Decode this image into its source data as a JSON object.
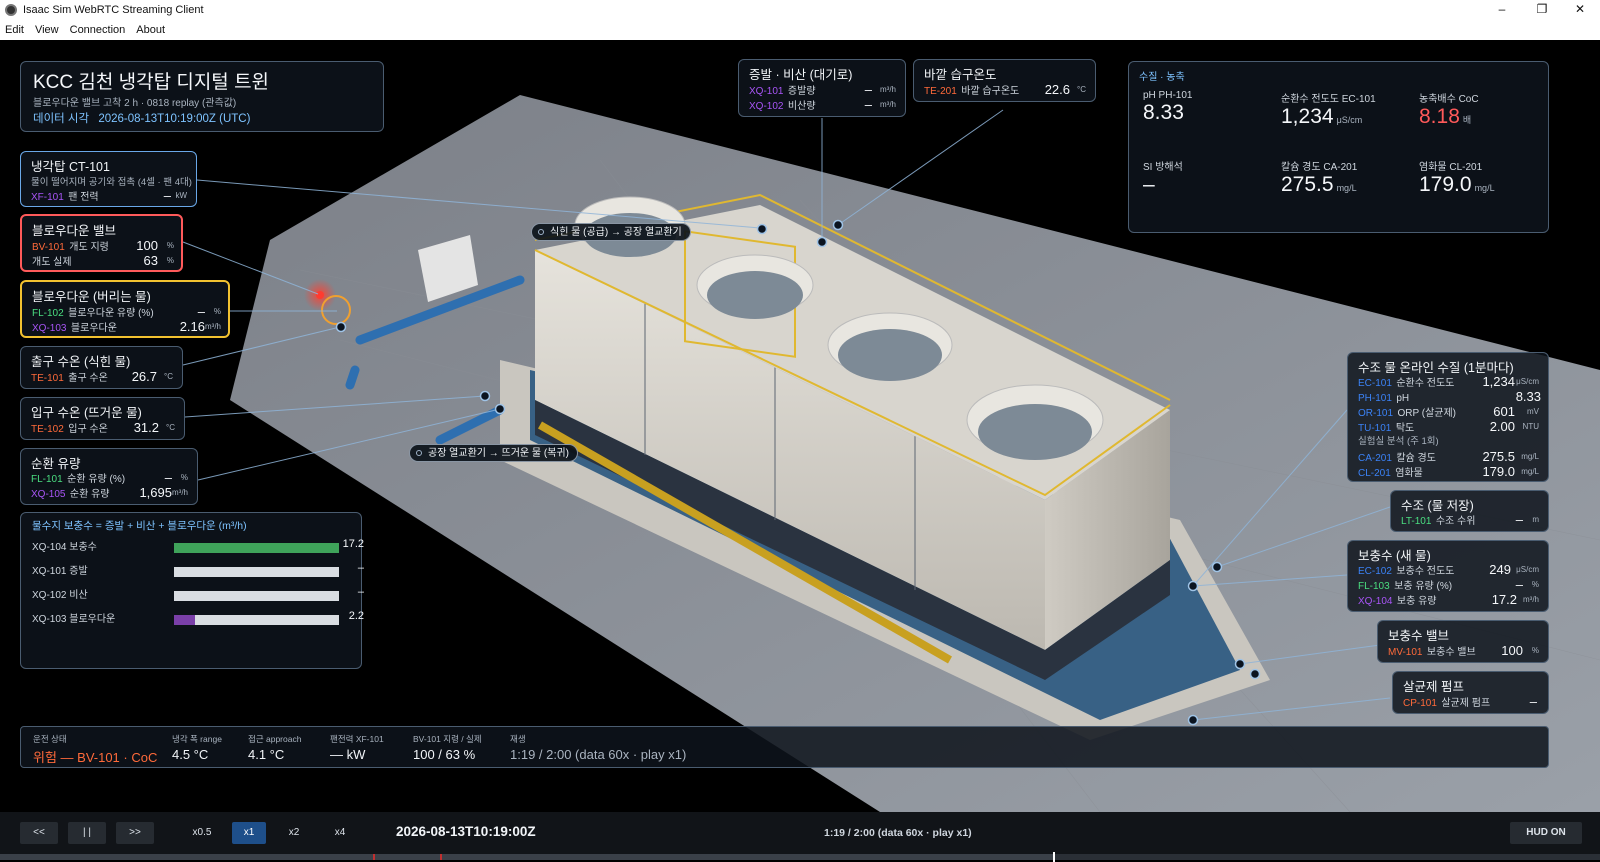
{
  "window": {
    "title": "Isaac Sim WebRTC Streaming Client",
    "min": "–",
    "max": "❐",
    "close": "✕"
  },
  "menu": [
    "Edit",
    "View",
    "Connection",
    "About"
  ],
  "header": {
    "title": "KCC 김천 냉각탑 디지털 트윈",
    "subtitle": "블로우다운 밸브 고착 2 h · 0818 replay (관측값)",
    "data_time_label": "데이터 시각",
    "data_time": "2026-08-13T10:19:00Z (UTC)"
  },
  "evap_panel": {
    "title": "증발 · 비산 (대기로)",
    "rows": [
      {
        "tag": "XQ-101",
        "label": "증발량",
        "value": "–",
        "unit": "m³/h"
      },
      {
        "tag": "XQ-102",
        "label": "비산량",
        "value": "–",
        "unit": "m³/h"
      }
    ]
  },
  "wetbulb_panel": {
    "title": "바깥 습구온도",
    "tag": "TE-201",
    "label": "바깥 습구온도",
    "value": "22.6",
    "unit": "°C"
  },
  "water_quality": {
    "title": "수질 · 농축",
    "items": [
      {
        "label": "pH  PH-101",
        "value": "8.33",
        "unit": ""
      },
      {
        "label": "순환수 전도도  EC-101",
        "value": "1,234",
        "unit": "μS/cm"
      },
      {
        "label": "농축배수 CoC",
        "value": "8.18",
        "unit": "배"
      },
      {
        "label": "SI 방해석",
        "value": "–",
        "unit": ""
      },
      {
        "label": "칼슘 경도  CA-201",
        "value": "275.5",
        "unit": "mg/L"
      },
      {
        "label": "염화물  CL-201",
        "value": "179.0",
        "unit": "mg/L"
      }
    ],
    "alert_color": "#ff5a5a"
  },
  "tower_panel": {
    "title": "냉각탑 CT-101",
    "desc": "물이 떨어지며 공기와 접촉 (4셀 · 팬 4대)",
    "tag": "XF-101",
    "label": "팬 전력",
    "value": "–",
    "unit": "kW"
  },
  "bd_valve_panel": {
    "title": "블로우다운 밸브",
    "rows": [
      {
        "tag": "BV-101",
        "label": "개도 지령",
        "value": "100",
        "unit": "%"
      },
      {
        "tag": "",
        "label": "개도 실제",
        "value": "63",
        "unit": "%"
      }
    ]
  },
  "bd_water_panel": {
    "title": "블로우다운 (버리는 물)",
    "rows": [
      {
        "tag": "FL-102",
        "label": "블로우다운 유량 (%)",
        "value": "–",
        "unit": "%"
      },
      {
        "tag": "XQ-103",
        "label": "블로우다운",
        "value": "2.16",
        "unit": "m³/h"
      }
    ]
  },
  "outlet_panel": {
    "title": "출구 수온 (식힌 물)",
    "tag": "TE-101",
    "label": "출구 수온",
    "value": "26.7",
    "unit": "°C"
  },
  "inlet_panel": {
    "title": "입구 수온 (뜨거운 물)",
    "tag": "TE-102",
    "label": "입구 수온",
    "value": "31.2",
    "unit": "°C"
  },
  "circ_panel": {
    "title": "순환 유량",
    "rows": [
      {
        "tag": "FL-101",
        "label": "순환 유량 (%)",
        "value": "–",
        "unit": "%"
      },
      {
        "tag": "XQ-105",
        "label": "순환 유량",
        "value": "1,695",
        "unit": "m³/h"
      }
    ]
  },
  "balance": {
    "title": "물수지  보충수 = 증발 + 비산 + 블로우다운  (m³/h)",
    "rows": [
      {
        "label": "XQ-104 보충수",
        "value": "17.2",
        "fraction": 1.0,
        "color": "#3fa35a"
      },
      {
        "label": "XQ-101 증발",
        "value": "–",
        "fraction": 0,
        "color": "#3fa35a"
      },
      {
        "label": "XQ-102 비산",
        "value": "–",
        "fraction": 0,
        "color": "#3fa35a"
      },
      {
        "label": "XQ-103 블로우다운",
        "value": "2.2",
        "fraction": 0.13,
        "color": "#7a3fa8"
      }
    ]
  },
  "basin_online": {
    "title": "수조 물 온라인 수질 (1분마다)",
    "rows": [
      {
        "tag": "EC-101",
        "label": "순환수 전도도",
        "value": "1,234",
        "unit": "μS/cm"
      },
      {
        "tag": "PH-101",
        "label": "pH",
        "value": "8.33",
        "unit": ""
      },
      {
        "tag": "OR-101",
        "label": "ORP (살균제)",
        "value": "601",
        "unit": "mV"
      },
      {
        "tag": "TU-101",
        "label": "탁도",
        "value": "2.00",
        "unit": "NTU"
      }
    ],
    "lab_title": "실험실 분석 (주 1회)",
    "lab_rows": [
      {
        "tag": "CA-201",
        "label": "칼슘 경도",
        "value": "275.5",
        "unit": "mg/L"
      },
      {
        "tag": "CL-201",
        "label": "염화물",
        "value": "179.0",
        "unit": "mg/L"
      }
    ]
  },
  "basin_level": {
    "title": "수조 (물 저장)",
    "tag": "LT-101",
    "label": "수조 수위",
    "value": "–",
    "unit": "m"
  },
  "makeup_panel": {
    "title": "보충수 (새 물)",
    "rows": [
      {
        "tag": "EC-102",
        "label": "보충수 전도도",
        "value": "249",
        "unit": "μS/cm"
      },
      {
        "tag": "FL-103",
        "label": "보충 유량 (%)",
        "value": "–",
        "unit": "%"
      },
      {
        "tag": "XQ-104",
        "label": "보충 유량",
        "value": "17.2",
        "unit": "m³/h"
      }
    ]
  },
  "makeup_valve": {
    "title": "보충수 밸브",
    "tag": "MV-101",
    "label": "보충수 밸브",
    "value": "100",
    "unit": "%"
  },
  "biocide_pump": {
    "title": "살균제 펌프",
    "tag": "CP-101",
    "label": "살균제 펌프",
    "value": "–",
    "unit": ""
  },
  "callouts": {
    "supply": "식힌 물 (공급) → 공장 열교환기",
    "return": "공장 열교환기 → 뜨거운 물 (복귀)"
  },
  "status": {
    "items": [
      {
        "k": "운전 상태",
        "v": "위험 — BV-101 · CoC"
      },
      {
        "k": "냉각 폭 range",
        "v": "4.5 °C"
      },
      {
        "k": "접근 approach",
        "v": "4.1 °C"
      },
      {
        "k": "팬전력 XF-101",
        "v": "— kW"
      },
      {
        "k": "BV-101 지령 / 실제",
        "v": "100 / 63 %"
      },
      {
        "k": "재생",
        "v": "1:19 / 2:00  (data 60x · play x1)"
      }
    ],
    "alert_color": "#ff6a3a"
  },
  "controls": {
    "rewind": "<<",
    "pause": "| |",
    "forward": ">>",
    "speeds": [
      "x0.5",
      "x1",
      "x2",
      "x4"
    ],
    "active_speed": "x1",
    "timestamp": "2026-08-13T10:19:00Z",
    "playback": "1:19 / 2:00  (data 60x · play x1)",
    "hud": "HUD ON",
    "progress": 0.658
  }
}
